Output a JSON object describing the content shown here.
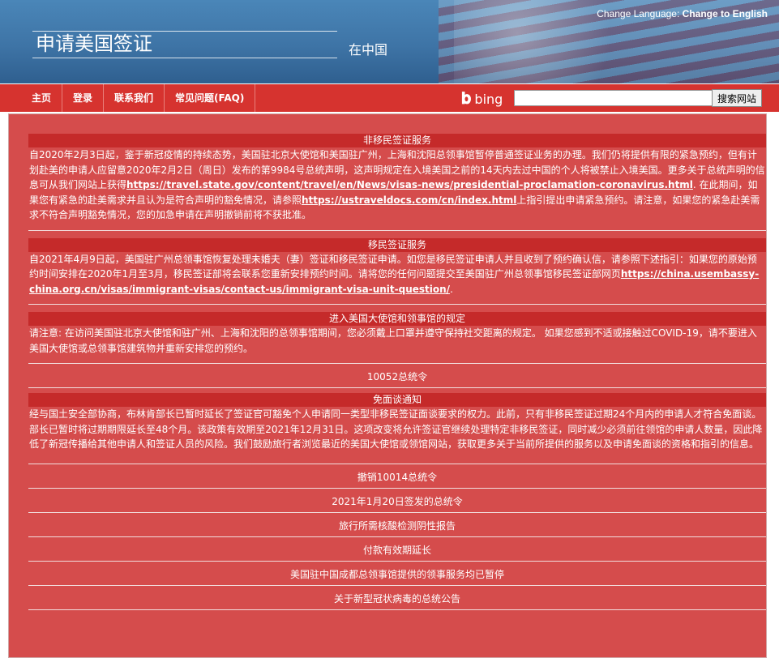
{
  "header": {
    "title": "申请美国签证",
    "subtitle": "在中国",
    "lang_prefix": "Change Language: ",
    "lang_link": "Change to English"
  },
  "nav": {
    "items": [
      "主页",
      "登录",
      "联系我们",
      "常见问题(FAQ)"
    ],
    "bing_label": "bing",
    "search_button": "搜索网站",
    "search_value": ""
  },
  "sections": [
    {
      "title": "非移民签证服务",
      "body_1": "自2020年2月3日起，鉴于新冠疫情的持续态势，美国驻北京大使馆和美国驻广州，上海和沈阳总领事馆暂停普通签证业务的办理。我们仍将提供有限的紧急预约，但有计划赴美的申请人应留意2020年2月2日（周日）发布的第9984号总统声明，这声明规定在入境美国之前的14天内去过中国的个人将被禁止入境美国。更多关于总统声明的信息可从我们网站上获得",
      "link_1": "https://travel.state.gov/content/travel/en/News/visas-news/presidential-proclamation-coronavirus.html",
      "body_2": ". 在此期间，如果您有紧急的赴美需求并且认为是符合声明的豁免情况，请参照",
      "link_2": "https://ustraveldocs.com/cn/index.html",
      "body_3": "上指引提出申请紧急预约。请注意，如果您的紧急赴美需求不符合声明豁免情况，您的加急申请在声明撤销前将不获批准。"
    },
    {
      "title": "移民签证服务",
      "body_1": "自2021年4月9日起，美国驻广州总领事馆恢复处理未婚夫（妻）签证和移民签证申请。如您是移民签证申请人并且收到了预约确认信，请参照下述指引：如果您的原始预约时间安排在2020年1月至3月，移民签证部将会联系您重新安排预约时间。请将您的任何问题提交至美国驻广州总领事馆移民签证部网页",
      "link_1": "https://china.usembassy-china.org.cn/visas/immigrant-visas/contact-us/immigrant-visa-unit-question/",
      "body_2": "."
    },
    {
      "title": "进入美国大使馆和领事馆的规定",
      "body_1": "请注意: 在访问美国驻北京大使馆和驻广州、上海和沈阳的总领事馆期间，您必须戴上口罩并遵守保持社交距离的规定。 如果您感到不适或接触过COVID-19，请不要进入美国大使馆或总领事馆建筑物并重新安排您的预约。"
    },
    {
      "title": "免面谈通知",
      "body_1": "经与国土安全部协商，布林肯部长已暂时延长了签证官可豁免个人申请同一类型非移民签证面谈要求的权力。此前，只有非移民签证过期24个月内的申请人才符合免面谈。部长已暂时将过期期限延长至48个月。该政策有效期至2021年12月31日。这项改变将允许签证官继续处理特定非移民签证，同时减少必须前往领馆的申请人数量，因此降低了新冠传播给其他申请人和签证人员的风险。我们鼓励旅行者浏览最近的美国大使馆或领馆网站，获取更多关于当前所提供的服务以及申请免面谈的资格和指引的信息。"
    }
  ],
  "links": {
    "proclamation_10052": "10052总统令",
    "revoke_10014": "撤销10014总统令",
    "order_jan20": "2021年1月20日签发的总统令",
    "covid_test": "旅行所需核酸检测阴性报告",
    "payment_extension": "付款有效期延长",
    "chengdu_suspended": "美国驻中国成都总领事馆提供的领事服务均已暂停",
    "covid_announcement": "关于新型冠状病毒的总统公告"
  },
  "colors": {
    "header_blue": "#3e74a6",
    "nav_red": "#d6332f",
    "panel_red": "#d54c4c",
    "title_red": "#c52a2a"
  }
}
